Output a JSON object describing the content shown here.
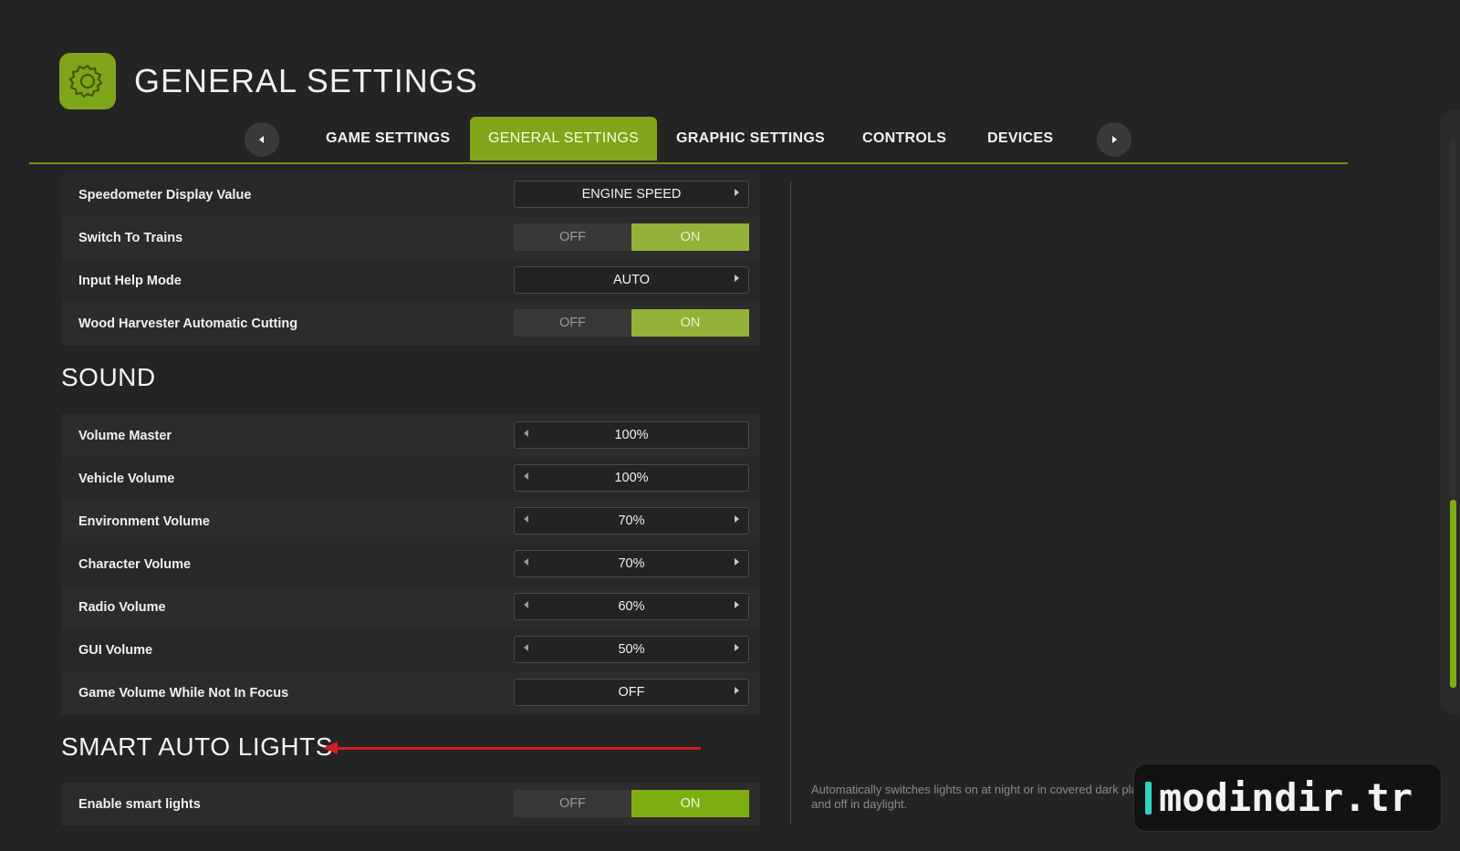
{
  "header": {
    "title": "GENERAL SETTINGS",
    "icon": "gear-icon"
  },
  "tabs": [
    {
      "label": "GAME SETTINGS",
      "active": false
    },
    {
      "label": "GENERAL SETTINGS",
      "active": true
    },
    {
      "label": "GRAPHIC SETTINGS",
      "active": false
    },
    {
      "label": "CONTROLS",
      "active": false
    },
    {
      "label": "DEVICES",
      "active": false
    }
  ],
  "general_rows": [
    {
      "label": "Speedometer Display Value",
      "type": "selector",
      "value": "ENGINE SPEED"
    },
    {
      "label": "Switch To Trains",
      "type": "toggle",
      "off": "OFF",
      "on": "ON",
      "value": "ON"
    },
    {
      "label": "Input Help Mode",
      "type": "selector",
      "value": "AUTO"
    },
    {
      "label": "Wood Harvester Automatic Cutting",
      "type": "toggle",
      "off": "OFF",
      "on": "ON",
      "value": "ON"
    }
  ],
  "sound": {
    "title": "SOUND",
    "rows": [
      {
        "label": "Volume Master",
        "value": "100%"
      },
      {
        "label": "Vehicle Volume",
        "value": "100%"
      },
      {
        "label": "Environment Volume",
        "value": "70%"
      },
      {
        "label": "Character Volume",
        "value": "70%"
      },
      {
        "label": "Radio Volume",
        "value": "60%"
      },
      {
        "label": "GUI Volume",
        "value": "50%"
      },
      {
        "label": "Game Volume While Not In Focus",
        "value": "OFF"
      }
    ]
  },
  "smart_lights": {
    "title": "SMART AUTO LIGHTS",
    "row": {
      "label": "Enable smart lights",
      "off": "OFF",
      "on": "ON",
      "value": "ON"
    },
    "description": "Automatically switches lights on at night or in covered dark places and off in daylight."
  },
  "watermark": {
    "text": "modindir.tr"
  },
  "colors": {
    "accent": "#7fa51a",
    "toggle_on": "#93b238",
    "annotation_arrow": "#d11d1d"
  }
}
